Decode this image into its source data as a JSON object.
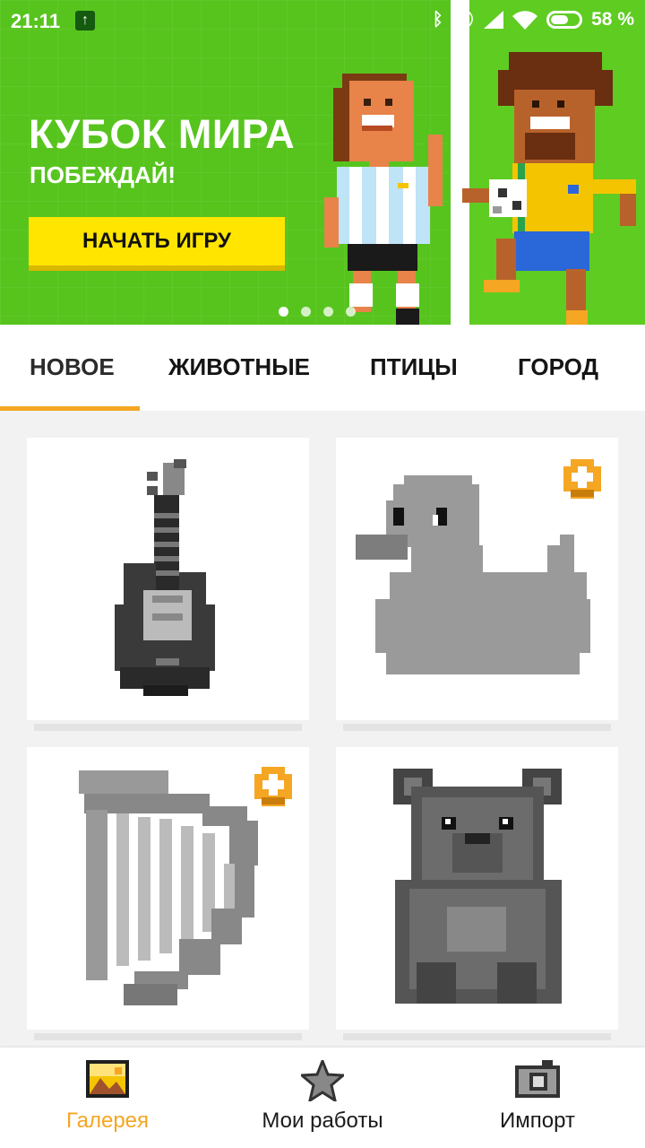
{
  "status_bar": {
    "time": "21:11",
    "battery_text": "58 %",
    "icons": [
      "upload-icon",
      "bluetooth-icon",
      "mute-icon",
      "signal-icon",
      "wifi-icon",
      "battery-icon"
    ]
  },
  "banner": {
    "title": "КУБОК МИРА",
    "subtitle": "ПОБЕЖДАЙ!",
    "button_label": "НАЧАТЬ ИГРУ",
    "dots": 4,
    "active_dot": 0,
    "colors": {
      "background": "#57c41e",
      "button": "#ffe500"
    }
  },
  "tabs": [
    {
      "label": "НОВОЕ",
      "active": true
    },
    {
      "label": "ЖИВОТНЫЕ",
      "active": false
    },
    {
      "label": "ПТИЦЫ",
      "active": false
    },
    {
      "label": "ГОРОД",
      "active": false
    }
  ],
  "gallery": [
    {
      "subject": "guitar",
      "locked": false
    },
    {
      "subject": "duck",
      "locked": true
    },
    {
      "subject": "harp",
      "locked": true
    },
    {
      "subject": "bear",
      "locked": false
    }
  ],
  "bottom_nav": [
    {
      "label": "Галерея",
      "icon": "gallery-icon",
      "active": true
    },
    {
      "label": "Мои работы",
      "icon": "star-icon",
      "active": false
    },
    {
      "label": "Импорт",
      "icon": "camera-icon",
      "active": false
    }
  ],
  "accent_color": "#f5a623"
}
